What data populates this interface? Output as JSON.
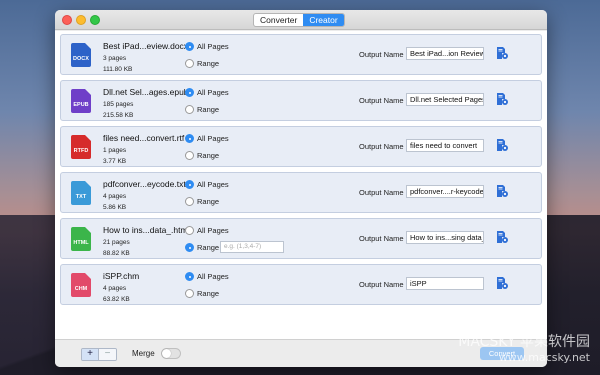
{
  "tabs": {
    "converter": "Converter",
    "creator": "Creator"
  },
  "options": {
    "all_pages": "All Pages",
    "range": "Range",
    "output_name_label": "Output Name"
  },
  "files": [
    {
      "name": "Best iPad...eview.docx",
      "pages": "3 pages",
      "size": "111.80 KB",
      "type": "DOCX",
      "color": "#2d62c8",
      "selection": "all",
      "output": "Best iPad...ion Review",
      "range_placeholder": ""
    },
    {
      "name": "Dll.net Sel...ages.epub",
      "pages": "185 pages",
      "size": "215.58 KB",
      "type": "EPUB",
      "color": "#6f3fc8",
      "selection": "all",
      "output": "Dll.net Selected Pages",
      "range_placeholder": ""
    },
    {
      "name": "files need...convert.rtf",
      "pages": "1 pages",
      "size": "3.77 KB",
      "type": "RTFD",
      "color": "#d62b2b",
      "selection": "all",
      "output": "files need to convert",
      "range_placeholder": ""
    },
    {
      "name": "pdfconver...eycode.txt",
      "pages": "4 pages",
      "size": "5.86 KB",
      "type": "TXT",
      "color": "#3a9ad8",
      "selection": "all",
      "output": "pdfconver....r-keycode",
      "range_placeholder": ""
    },
    {
      "name": "How to ins...data_.html",
      "pages": "21 pages",
      "size": "88.82 KB",
      "type": "HTML",
      "color": "#3bb54a",
      "selection": "range",
      "output": "How to ins...sing data_",
      "range_placeholder": "e.g. (1,3,4-7)"
    },
    {
      "name": "iSPP.chm",
      "pages": "4 pages",
      "size": "63.82 KB",
      "type": "CHM",
      "color": "#e24a6a",
      "selection": "all",
      "output": "iSPP",
      "range_placeholder": ""
    }
  ],
  "footer": {
    "plus": "+",
    "minus": "−",
    "merge_label": "Merge",
    "merge_on": false,
    "convert_label": "Convert"
  },
  "watermark": {
    "line1": "MACSKY 苹果软件园",
    "line2": "www.macsky.net"
  },
  "colors": {
    "accent": "#2f8cf2"
  }
}
